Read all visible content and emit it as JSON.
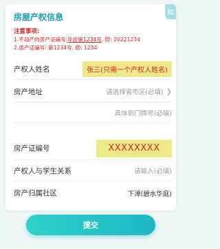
{
  "title": "房屋产权信息",
  "corner_badge": "知",
  "notice": {
    "heading": "注意事项:",
    "line1_prefix": "1.不动产的房产证编号:",
    "line1_underlined": "年份第1234号",
    "line1_suffix": ", 即: 20221234",
    "line2": "2.房产证编号: 第1234号, 即: 1234"
  },
  "fields": {
    "owner_name": {
      "label": "产权人姓名",
      "value": "张三(只需一个产权人姓名)"
    },
    "address": {
      "label": "房产地址",
      "placeholder": "请选择省市区(必填)",
      "detail_placeholder": "具体到门牌号(必填)"
    },
    "cert_number": {
      "label": "房产证编号",
      "value": "XXXXXXXX"
    },
    "relation": {
      "label": "产权人与学生关系",
      "placeholder": "请输入(必填)"
    },
    "community": {
      "label": "房产归属社区",
      "value": "下漳(碧水华庭)"
    }
  },
  "submit_label": "提交"
}
